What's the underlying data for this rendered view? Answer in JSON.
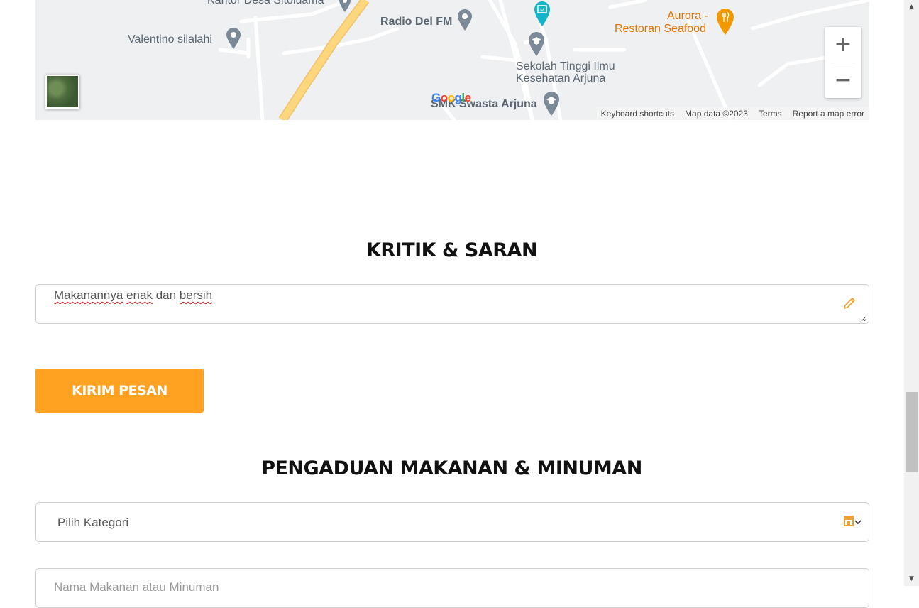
{
  "map": {
    "places": {
      "kantor_desa": "Kantor Desa Sitoluama",
      "valentino": "Valentino silalahi",
      "radio": "Radio Del FM",
      "aurora_line1": "Aurora -",
      "aurora_line2": "Restoran Seafood",
      "sekolah_line1": "Sekolah Tinggi Ilmu",
      "sekolah_line2": "Kesehatan Arjuna",
      "smk": "SMK Swasta Arjuna"
    },
    "google_logo": "Google",
    "zoom_in": "+",
    "zoom_out": "−",
    "attribution": {
      "keyboard": "Keyboard shortcuts",
      "map_data": "Map data ©2023",
      "terms": "Terms",
      "report": "Report a map error"
    }
  },
  "kritik": {
    "title": "KRITIK & SARAN",
    "text_word1": "Makanannya",
    "text_word2": "enak",
    "text_word3": "dan",
    "text_word4": "bersih",
    "submit_label": "KIRIM PESAN"
  },
  "pengaduan": {
    "title": "PENGADUAN MAKANAN & MINUMAN",
    "category_selected": "Pilih Kategori",
    "name_placeholder": "Nama Makanan atau Minuman"
  },
  "colors": {
    "accent": "#ffa221",
    "road_major": "#fdd77e",
    "map_bg": "#eef0f2"
  },
  "icons": {
    "pencil": "pencil-icon",
    "store": "store-icon",
    "chevron": "chevron-down-icon",
    "zoom_in": "plus-icon",
    "zoom_out": "minus-icon"
  }
}
